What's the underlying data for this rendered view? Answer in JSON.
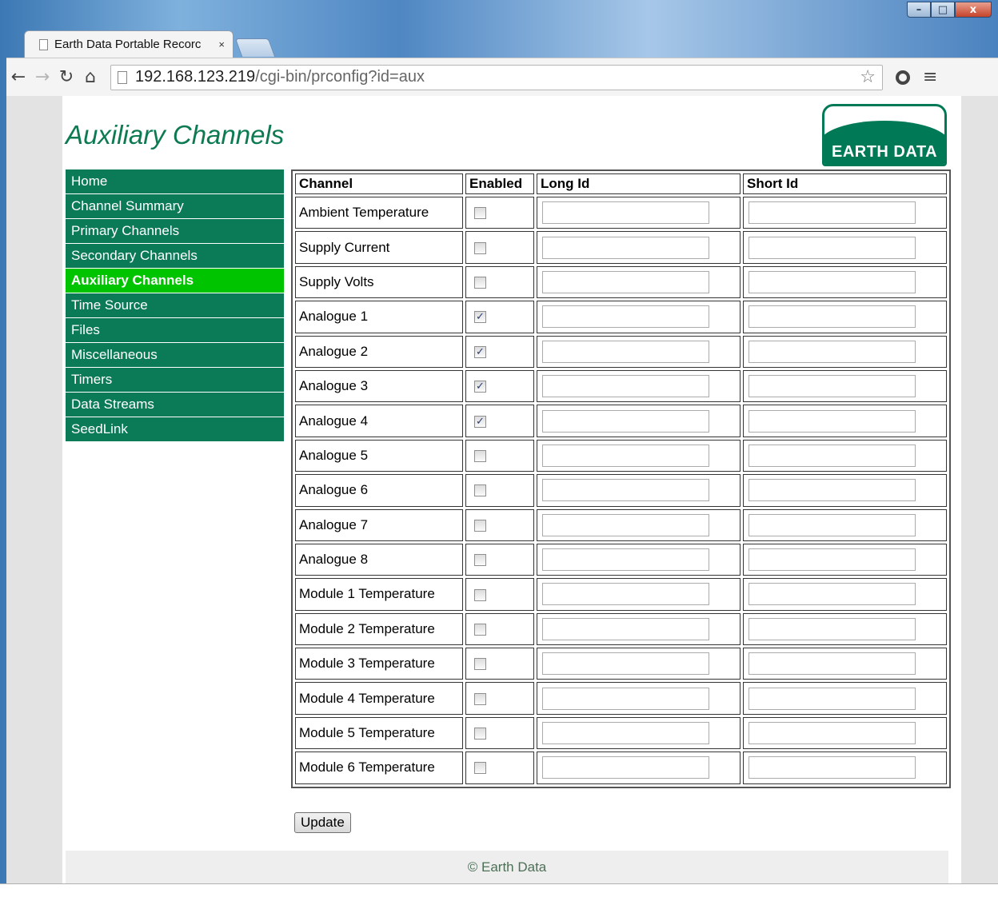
{
  "browser": {
    "tab_title": "Earth Data Portable Recorc",
    "tab_close": "×",
    "url_host": "192.168.123.219",
    "url_path": "/cgi-bin/prconfig?id=aux",
    "window_controls": {
      "minimize": "–",
      "maximize": "□",
      "close": "x"
    }
  },
  "page": {
    "title": "Auxiliary Channels",
    "logo_text": "EARTH DATA"
  },
  "nav": {
    "items": [
      {
        "label": "Home"
      },
      {
        "label": "Channel Summary"
      },
      {
        "label": "Primary Channels"
      },
      {
        "label": "Secondary Channels"
      },
      {
        "label": "Auxiliary Channels",
        "active": true
      },
      {
        "label": "Time Source"
      },
      {
        "label": "Files"
      },
      {
        "label": "Miscellaneous"
      },
      {
        "label": "Timers"
      },
      {
        "label": "Data Streams"
      },
      {
        "label": "SeedLink"
      }
    ]
  },
  "table": {
    "headers": [
      "Channel",
      "Enabled",
      "Long Id",
      "Short Id"
    ],
    "rows": [
      {
        "channel": "Ambient Temperature",
        "enabled": false,
        "long_id": "",
        "short_id": ""
      },
      {
        "channel": "Supply Current",
        "enabled": false,
        "long_id": "",
        "short_id": ""
      },
      {
        "channel": "Supply Volts",
        "enabled": false,
        "long_id": "",
        "short_id": ""
      },
      {
        "channel": "Analogue 1",
        "enabled": true,
        "long_id": "",
        "short_id": ""
      },
      {
        "channel": "Analogue 2",
        "enabled": true,
        "long_id": "",
        "short_id": ""
      },
      {
        "channel": "Analogue 3",
        "enabled": true,
        "long_id": "",
        "short_id": ""
      },
      {
        "channel": "Analogue 4",
        "enabled": true,
        "long_id": "",
        "short_id": ""
      },
      {
        "channel": "Analogue 5",
        "enabled": false,
        "long_id": "",
        "short_id": ""
      },
      {
        "channel": "Analogue 6",
        "enabled": false,
        "long_id": "",
        "short_id": ""
      },
      {
        "channel": "Analogue 7",
        "enabled": false,
        "long_id": "",
        "short_id": ""
      },
      {
        "channel": "Analogue 8",
        "enabled": false,
        "long_id": "",
        "short_id": ""
      },
      {
        "channel": "Module 1 Temperature",
        "enabled": false,
        "long_id": "",
        "short_id": ""
      },
      {
        "channel": "Module 2 Temperature",
        "enabled": false,
        "long_id": "",
        "short_id": ""
      },
      {
        "channel": "Module 3 Temperature",
        "enabled": false,
        "long_id": "",
        "short_id": ""
      },
      {
        "channel": "Module 4 Temperature",
        "enabled": false,
        "long_id": "",
        "short_id": ""
      },
      {
        "channel": "Module 5 Temperature",
        "enabled": false,
        "long_id": "",
        "short_id": ""
      },
      {
        "channel": "Module 6 Temperature",
        "enabled": false,
        "long_id": "",
        "short_id": ""
      }
    ]
  },
  "actions": {
    "update_label": "Update"
  },
  "footer": {
    "text": "© Earth Data"
  },
  "colors": {
    "brand_green": "#0b7a56",
    "active_green": "#00c400",
    "title_green": "#0d7a52"
  }
}
